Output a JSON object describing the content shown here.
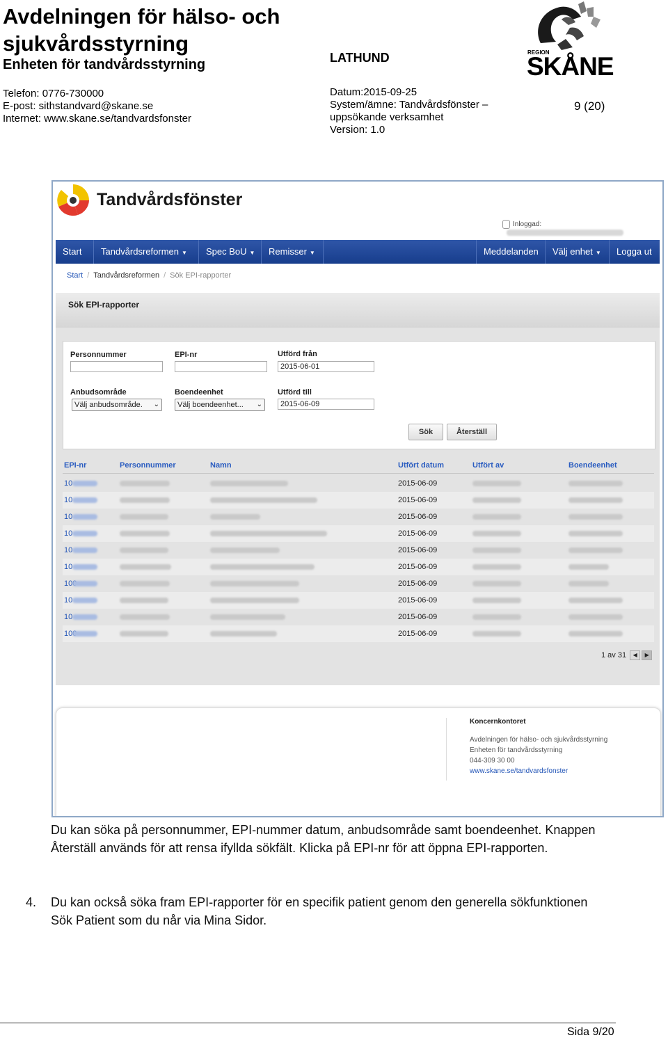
{
  "doc_header": {
    "org": "Avdelningen för hälso- och sjukvårdsstyrning",
    "unit": "Enheten för tandvårdsstyrning",
    "doc_type": "LATHUND",
    "phone": "Telefon: 0776-730000",
    "email": "E-post: sithstandvard@skane.se",
    "internet": "Internet: www.skane.se/tandvardsfonster",
    "date": "Datum:2015-09-25",
    "system": "System/ämne: Tandvårdsfönster – uppsökande verksamhet",
    "version": "Version: 1.0",
    "page": "9 (20)",
    "logo_region": "REGION",
    "logo_name": "SKÅNE"
  },
  "app": {
    "title": "Tandvårdsfönster",
    "login_label": "Inloggad:",
    "nav_left": [
      "Start",
      "Tandvårdsreformen",
      "Spec BoU",
      "Remisser"
    ],
    "nav_right": [
      "Meddelanden",
      "Välj enhet",
      "Logga ut"
    ],
    "breadcrumb": [
      "Start",
      "Tandvårdsreformen",
      "Sök EPI-rapporter"
    ],
    "panel_title": "Sök EPI-rapporter",
    "fields": {
      "personnummer_label": "Personnummer",
      "epi_label": "EPI-nr",
      "from_label": "Utförd från",
      "from_value": "2015-06-01",
      "area_label": "Anbudsområde",
      "area_value": "Välj anbudsområde.",
      "unit_label": "Boendeenhet",
      "unit_value": "Välj boendeenhet...",
      "to_label": "Utförd till",
      "to_value": "2015-06-09"
    },
    "buttons": {
      "search": "Sök",
      "reset": "Återställ"
    },
    "table": {
      "headers": [
        "EPI-nr",
        "Personnummer",
        "Namn",
        "Utfört datum",
        "Utfört av",
        "Boendeenhet"
      ],
      "epi_prefixes": [
        "10",
        "10",
        "10",
        "10",
        "10",
        "10",
        "100",
        "10",
        "10",
        "100"
      ],
      "dates": [
        "2015-06-09",
        "2015-06-09",
        "2015-06-09",
        "2015-06-09",
        "2015-06-09",
        "2015-06-09",
        "2015-06-09",
        "2015-06-09",
        "2015-06-09",
        "2015-06-09"
      ]
    },
    "pager": "1 av 31",
    "footer": {
      "heading": "Koncernkontoret",
      "line1": "Avdelningen för hälso- och sjukvårdsstyrning",
      "line2": "Enheten för tandvårdsstyrning",
      "line3": "044-309 30 00",
      "link": "www.skane.se/tandvardsfonster"
    }
  },
  "body": {
    "para1": "Du kan söka på personnummer, EPI-nummer datum, anbudsområde samt boendeenhet. Knappen Återställ används för att rensa ifyllda sökfält. Klicka på EPI-nr för att öppna EPI-rapporten.",
    "item4_num": "4.",
    "item4": "Du kan också söka fram EPI-rapporter för en specifik patient genom den generella sökfunktionen Sök Patient som du når via Mina Sidor."
  },
  "page_footer": "Sida 9/20",
  "colors": {
    "nav": "#2f56a8",
    "link": "#2355b7",
    "header_link": "#2a5cc0",
    "frame": "#8fa8c7"
  }
}
